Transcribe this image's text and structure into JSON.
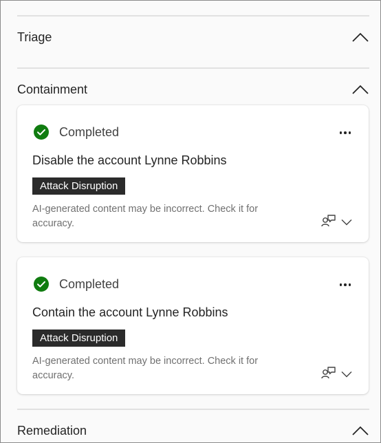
{
  "sections": {
    "triage": {
      "title": "Triage"
    },
    "containment": {
      "title": "Containment"
    },
    "remediation": {
      "title": "Remediation"
    }
  },
  "cards": [
    {
      "status": "Completed",
      "title": "Disable the account Lynne Robbins",
      "badge": "Attack Disruption",
      "disclaimer": "AI-generated content may be incorrect. Check it for accuracy."
    },
    {
      "status": "Completed",
      "title": "Contain the account Lynne Robbins",
      "badge": "Attack Disruption",
      "disclaimer": "AI-generated content may be incorrect. Check it for accuracy."
    }
  ],
  "icons": {
    "status": "check-circle-icon",
    "more": "more-horizontal-icon",
    "feedback": "feedback-icon",
    "collapse": "chevron-up-icon",
    "expand": "chevron-down-icon"
  },
  "colors": {
    "success": "#107c10",
    "badge_bg": "#2b2b2b",
    "background": "#fafafa"
  }
}
